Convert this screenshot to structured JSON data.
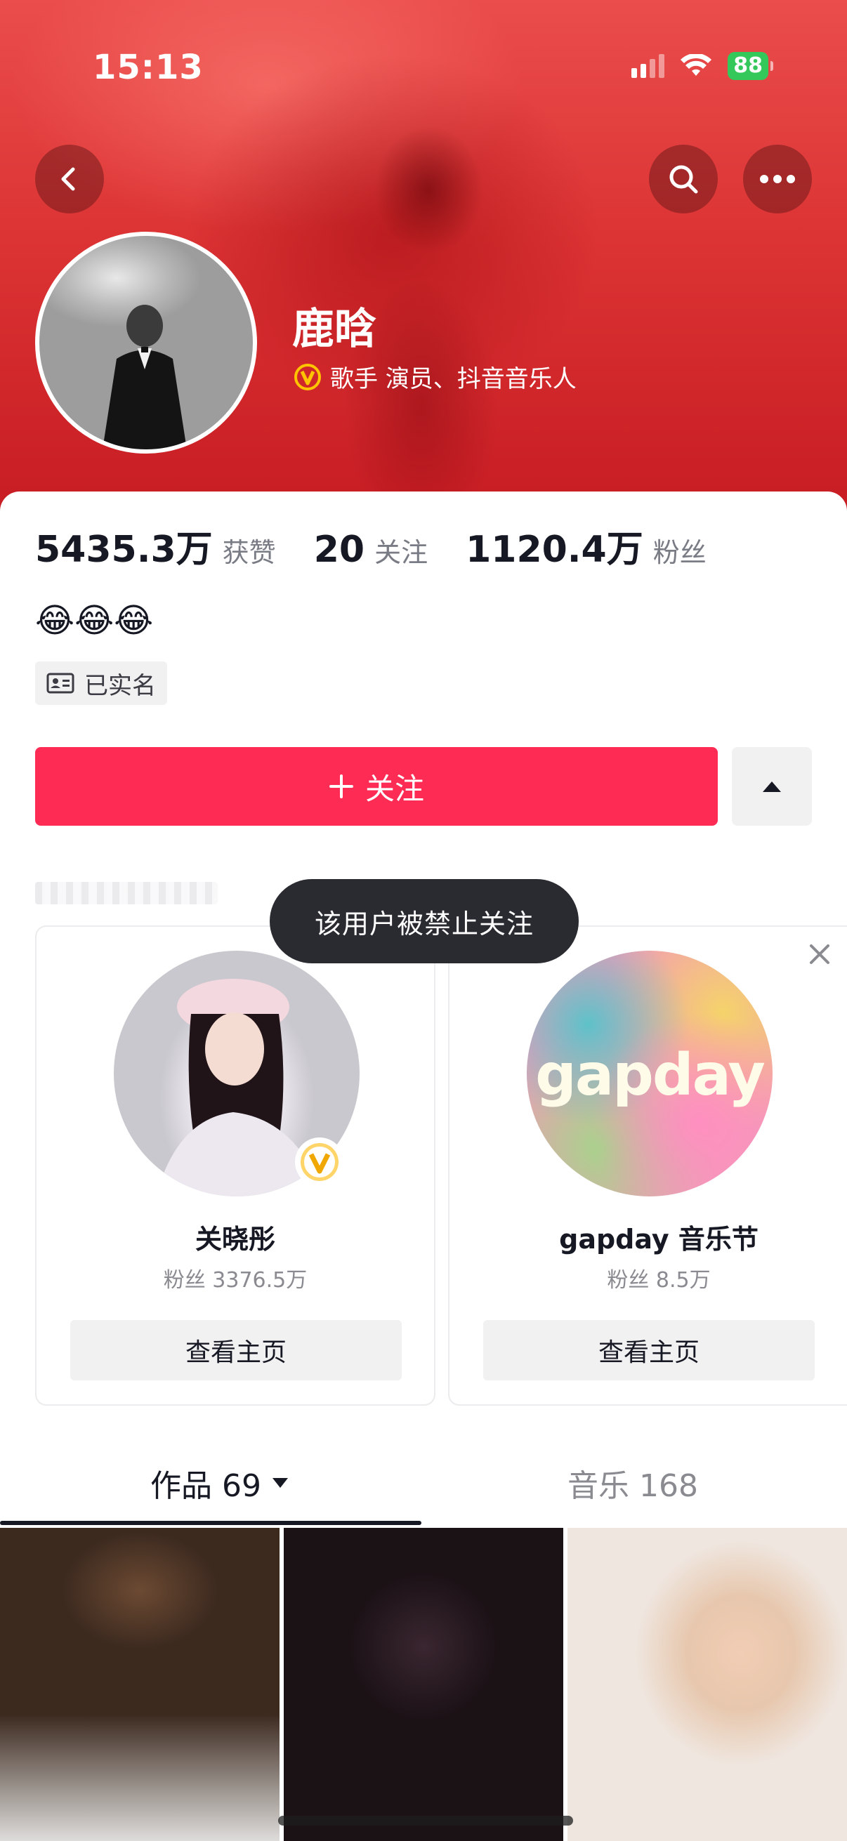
{
  "status_bar": {
    "time": "15:13",
    "battery": "88"
  },
  "header": {
    "name": "鹿晗",
    "verification": "歌手 演员、抖音音乐人",
    "background_color": "#dc3334"
  },
  "stats": [
    {
      "value": "5435.3万",
      "label": "获赞"
    },
    {
      "value": "20",
      "label": "关注"
    },
    {
      "value": "1120.4万",
      "label": "粉丝"
    }
  ],
  "bio": {
    "emojis": "😂😂😂"
  },
  "realname_tag": "已实名",
  "follow": {
    "label": "关注",
    "color": "#fe2c55"
  },
  "toast": "该用户被禁止关注",
  "recommendations": [
    {
      "name": "关晓彤",
      "fans": "粉丝 3376.5万",
      "button": "查看主页",
      "verified": true
    },
    {
      "name": "gapday 音乐节",
      "fans": "粉丝 8.5万",
      "button": "查看主页",
      "logo_text": "gapday"
    }
  ],
  "tabs": [
    {
      "label": "作品 69",
      "active": true
    },
    {
      "label": "音乐 168",
      "active": false
    }
  ],
  "icons": [
    "back-icon",
    "search-icon",
    "more-icon",
    "verified-v-icon",
    "id-card-icon",
    "plus-icon",
    "caret-up-icon",
    "close-icon",
    "caret-down-icon",
    "wifi-icon",
    "signal-icon",
    "battery-icon"
  ]
}
